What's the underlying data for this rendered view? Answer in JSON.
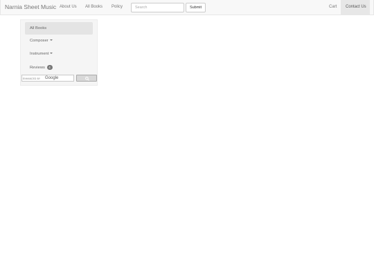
{
  "navbar": {
    "brand": "Narnia Sheet Music",
    "links": [
      "About Us",
      "All Books",
      "Policy"
    ],
    "search_placeholder": "Search",
    "submit_label": "Submit",
    "cart_label": "Cart",
    "contact_label": "Contact Us"
  },
  "sidebar": {
    "items": [
      {
        "label": "All Books",
        "active": true
      },
      {
        "label": "Composer",
        "dropdown": true
      },
      {
        "label": "Instrument",
        "dropdown": true
      },
      {
        "label": "Reviews",
        "badge": "4"
      }
    ]
  },
  "google_search": {
    "enhanced_by": "ENHANCED BY",
    "brand": "Google",
    "button_icon": "search-icon"
  }
}
